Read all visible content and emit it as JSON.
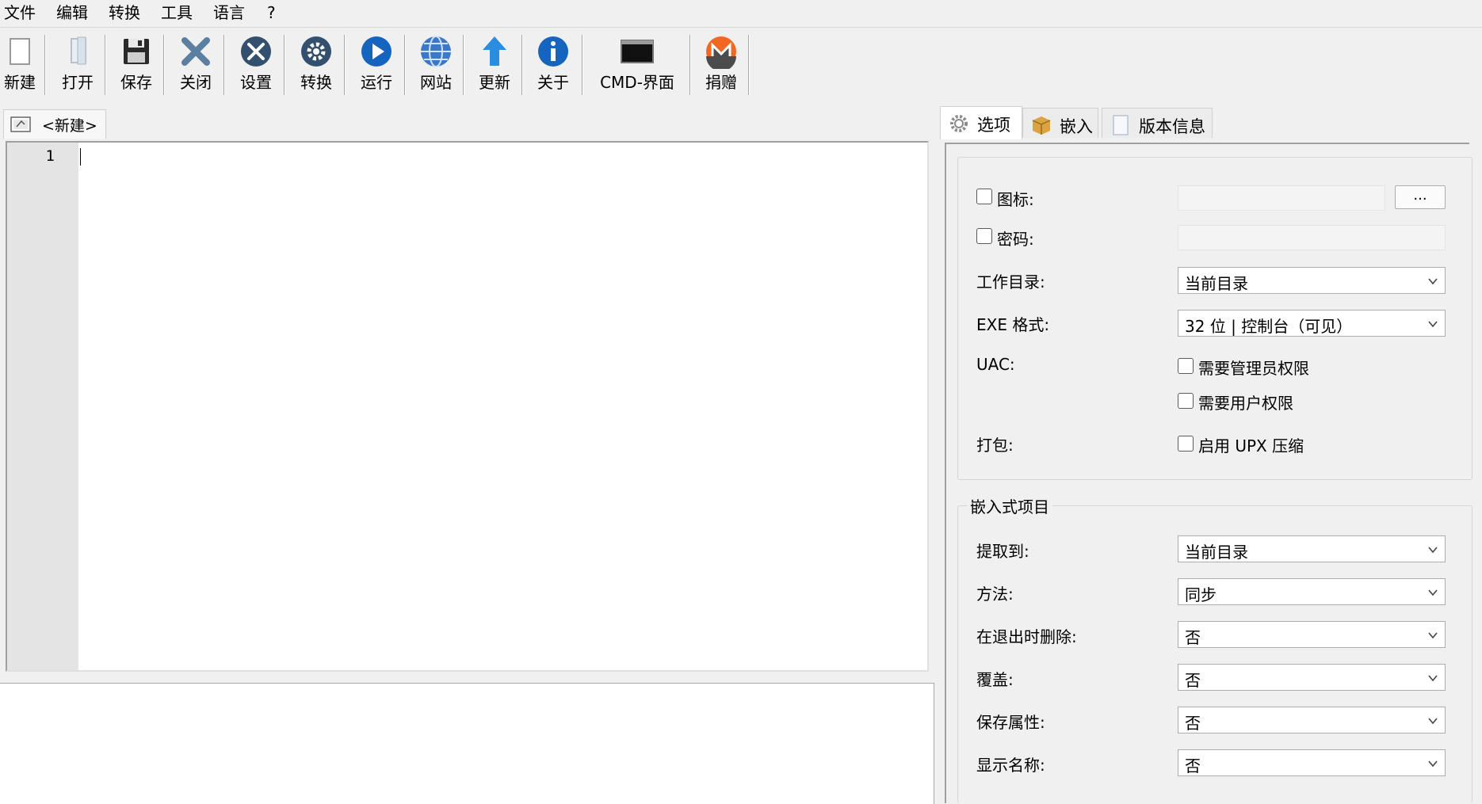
{
  "menu": [
    "文件",
    "编辑",
    "转换",
    "工具",
    "语言",
    "?"
  ],
  "toolbar": {
    "new": "新建",
    "open": "打开",
    "save": "保存",
    "close": "关闭",
    "settings": "设置",
    "convert": "转换",
    "run": "运行",
    "website": "网站",
    "update": "更新",
    "about": "关于",
    "cmd": "CMD-界面",
    "donate": "捐赠"
  },
  "editor": {
    "tab_title": "<新建>",
    "line_number": "1"
  },
  "tabs": {
    "options": "选项",
    "embed": "嵌入",
    "version": "版本信息"
  },
  "options": {
    "icon_label": "图标:",
    "browse_label": "...",
    "password_label": "密码:",
    "workdir_label": "工作目录:",
    "workdir_value": "当前目录",
    "exe_label": "EXE 格式:",
    "exe_value": "32 位 | 控制台（可见）",
    "uac_label": "UAC:",
    "uac_admin": "需要管理员权限",
    "uac_user": "需要用户权限",
    "pack_label": "打包:",
    "upx": "启用 UPX 压缩"
  },
  "embedded": {
    "title": "嵌入式项目",
    "extract_label": "提取到:",
    "extract_value": "当前目录",
    "method_label": "方法:",
    "method_value": "同步",
    "delete_label": "在退出时删除:",
    "delete_value": "否",
    "overwrite_label": "覆盖:",
    "overwrite_value": "否",
    "keepattr_label": "保存属性:",
    "keepattr_value": "否",
    "showname_label": "显示名称:",
    "showname_value": "否"
  },
  "colors": {
    "accent_blue": "#1565c0",
    "donate_orange": "#f26822"
  }
}
